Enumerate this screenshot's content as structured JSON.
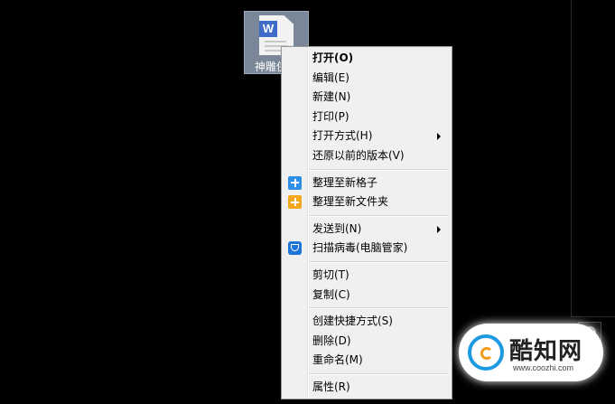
{
  "desktop": {
    "file": {
      "name": "神雕侠侣",
      "badge_letter": "W"
    }
  },
  "context_menu": {
    "groups": [
      [
        {
          "label": "打开(O)",
          "bold": true,
          "submenu": false
        },
        {
          "label": "编辑(E)"
        },
        {
          "label": "新建(N)"
        },
        {
          "label": "打印(P)"
        },
        {
          "label": "打开方式(H)",
          "submenu": true
        },
        {
          "label": "还原以前的版本(V)"
        }
      ],
      [
        {
          "label": "整理至新格子",
          "icon": "blue-plus-icon"
        },
        {
          "label": "整理至新文件夹",
          "icon": "orange-plus-icon"
        }
      ],
      [
        {
          "label": "发送到(N)",
          "submenu": true
        },
        {
          "label": "扫描病毒(电脑管家)",
          "icon": "shield-icon"
        }
      ],
      [
        {
          "label": "剪切(T)"
        },
        {
          "label": "复制(C)"
        }
      ],
      [
        {
          "label": "创建快捷方式(S)"
        },
        {
          "label": "删除(D)"
        },
        {
          "label": "重命名(M)"
        }
      ],
      [
        {
          "label": "属性(R)"
        }
      ]
    ]
  },
  "watermark": {
    "title": "酷知网",
    "url": "www.coozhi.com"
  }
}
